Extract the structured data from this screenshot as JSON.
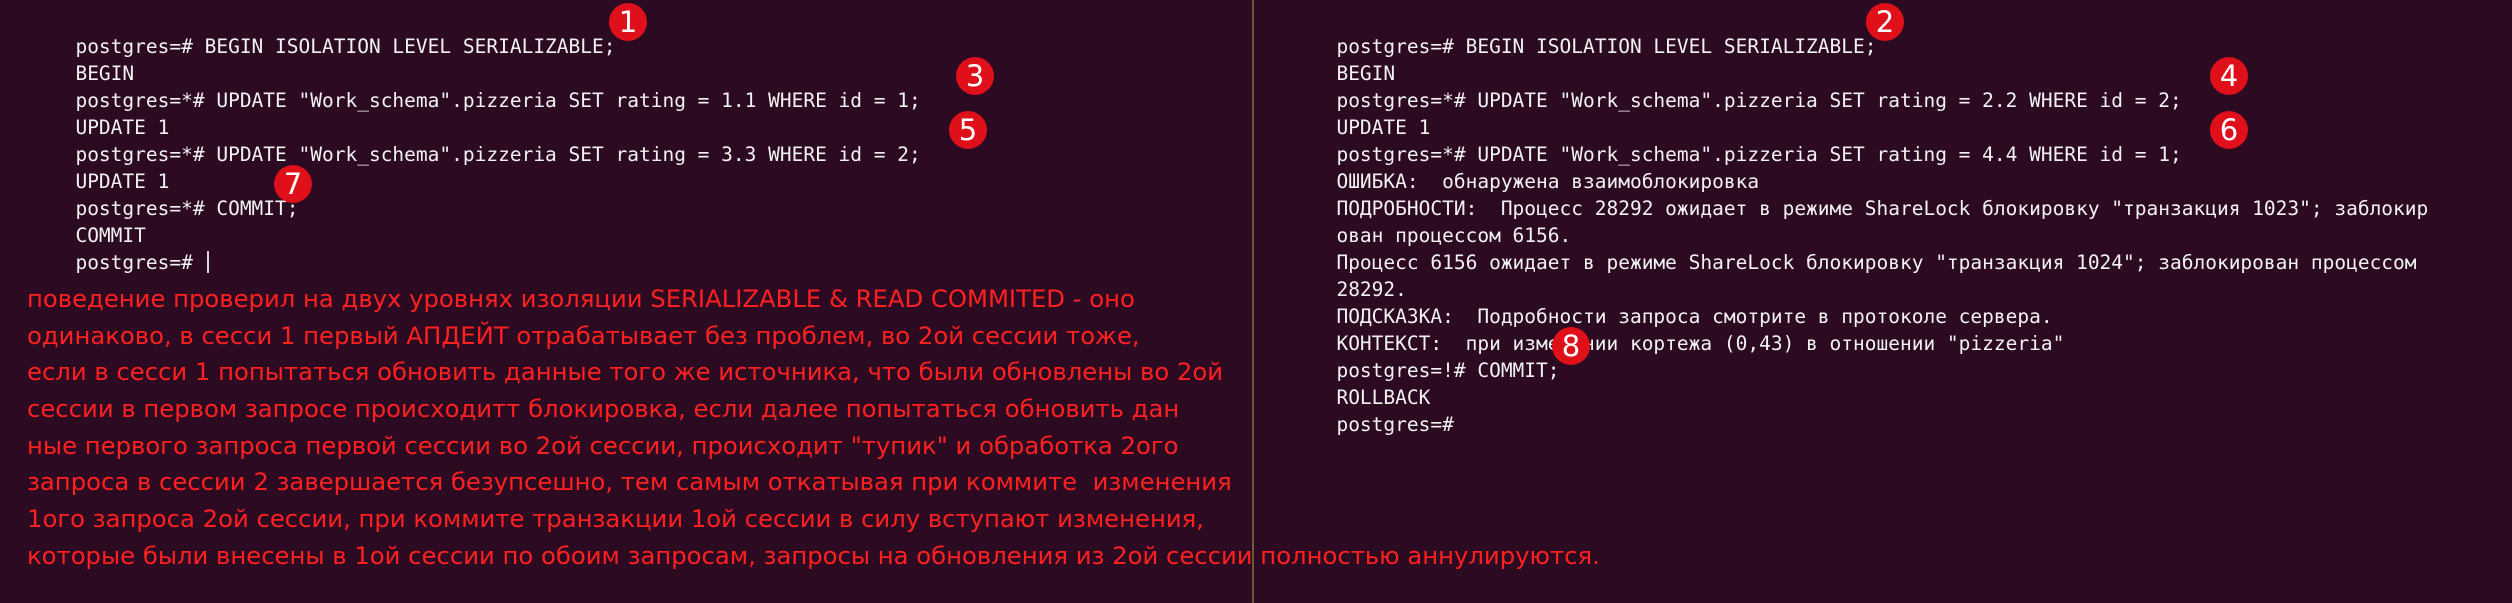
{
  "left_terminal": {
    "lines": [
      "postgres=# BEGIN ISOLATION LEVEL SERIALIZABLE;",
      "BEGIN",
      "postgres=*# UPDATE \"Work_schema\".pizzeria SET rating = 1.1 WHERE id = 1;",
      "UPDATE 1",
      "postgres=*# UPDATE \"Work_schema\".pizzeria SET rating = 3.3 WHERE id = 2;",
      "UPDATE 1",
      "postgres=*# COMMIT;",
      "COMMIT",
      "postgres=# "
    ],
    "markers": [
      "1",
      "3",
      "5",
      "7"
    ]
  },
  "right_terminal": {
    "lines": [
      "postgres=# BEGIN ISOLATION LEVEL SERIALIZABLE;",
      "BEGIN",
      "postgres=*# UPDATE \"Work_schema\".pizzeria SET rating = 2.2 WHERE id = 2;",
      "UPDATE 1",
      "postgres=*# UPDATE \"Work_schema\".pizzeria SET rating = 4.4 WHERE id = 1;",
      "ОШИБКА:  обнаружена взаимоблокировка",
      "ПОДРОБНОСТИ:  Процесс 28292 ожидает в режиме ShareLock блокировку \"транзакция 1023\"; заблокир",
      "ован процессом 6156.",
      "Процесс 6156 ожидает в режиме ShareLock блокировку \"транзакция 1024\"; заблокирован процессом",
      "28292.",
      "ПОДСКАЗКА:  Подробности запроса смотрите в протоколе сервера.",
      "КОНТЕКСТ:  при изменении кортежа (0,43) в отношении \"pizzeria\"",
      "postgres=!# COMMIT;",
      "ROLLBACK",
      "postgres=# "
    ],
    "markers": [
      "2",
      "4",
      "6",
      "8"
    ]
  },
  "annotation": {
    "lines": [
      "поведение проверил на двух уровнях изоляции SERIALIZABLE & READ COMMITED - оно",
      "одинаково, в сесси 1 первый АПДЕЙТ отрабатывает без проблем, во 2ой сессии тоже,",
      "если в сесси 1 попытаться обновить данные того же источника, что были обновлены во 2ой",
      "сессии в первом запросе происходитт блокировка, если далее попытаться обновить дан",
      "ные первого запроса первой сессии во 2ой сессии, происходит \"тупик\" и обработка 2ого",
      "запроса в сессии 2 завершается безупсешно, тем самым откатывая при коммите  изменения",
      "1ого запроса 2ой сессии, при коммите транзакции 1ой сессии в силу вступают изменения,",
      "которые были внесены в 1ой сессии по обоим запросам, запросы на обновления из 2ой сессии полностью аннулируются."
    ]
  },
  "colors": {
    "background": "#2c0a22",
    "terminal_text": "#f2f2f2",
    "annotation_text": "#ff2020",
    "marker_fill": "#e0101a"
  }
}
